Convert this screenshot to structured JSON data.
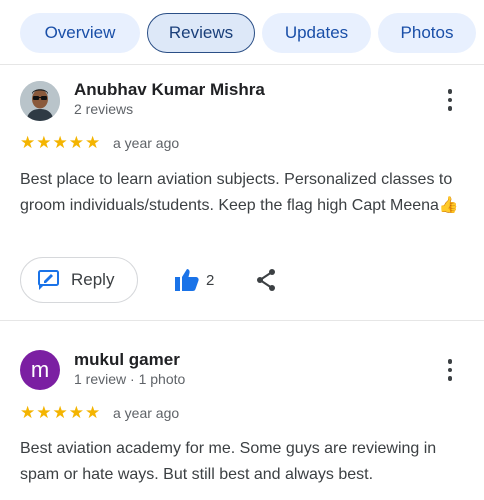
{
  "tabs": [
    {
      "label": "Overview"
    },
    {
      "label": "Reviews"
    },
    {
      "label": "Updates"
    },
    {
      "label": "Photos"
    }
  ],
  "reviews": [
    {
      "author": "Anubhav Kumar Mishra",
      "meta": "2 reviews",
      "rating": 5,
      "stars": "★★★★★",
      "time": "a year ago",
      "text": "Best place to learn aviation subjects. Personalized classes to groom individuals/students. Keep the flag high Capt Meena👍",
      "reply_label": "Reply",
      "likes": "2"
    },
    {
      "avatar_letter": "m",
      "author": "mukul gamer",
      "meta": "1 review · 1 photo",
      "rating": 5,
      "stars": "★★★★★",
      "time": "a year ago",
      "text": "Best aviation academy for me. Some guys are reviewing in spam or hate ways. But still best and always best."
    }
  ],
  "colors": {
    "tab_bg": "#e8f0fe",
    "tab_active_border": "#2b4f86",
    "star": "#f4b400",
    "like_icon": "#1a73e8",
    "avatar_letter_bg": "#7b1fa2"
  },
  "icons": [
    "more-vert-icon",
    "star-icon",
    "reply-icon",
    "thumb-up-icon",
    "share-icon"
  ]
}
